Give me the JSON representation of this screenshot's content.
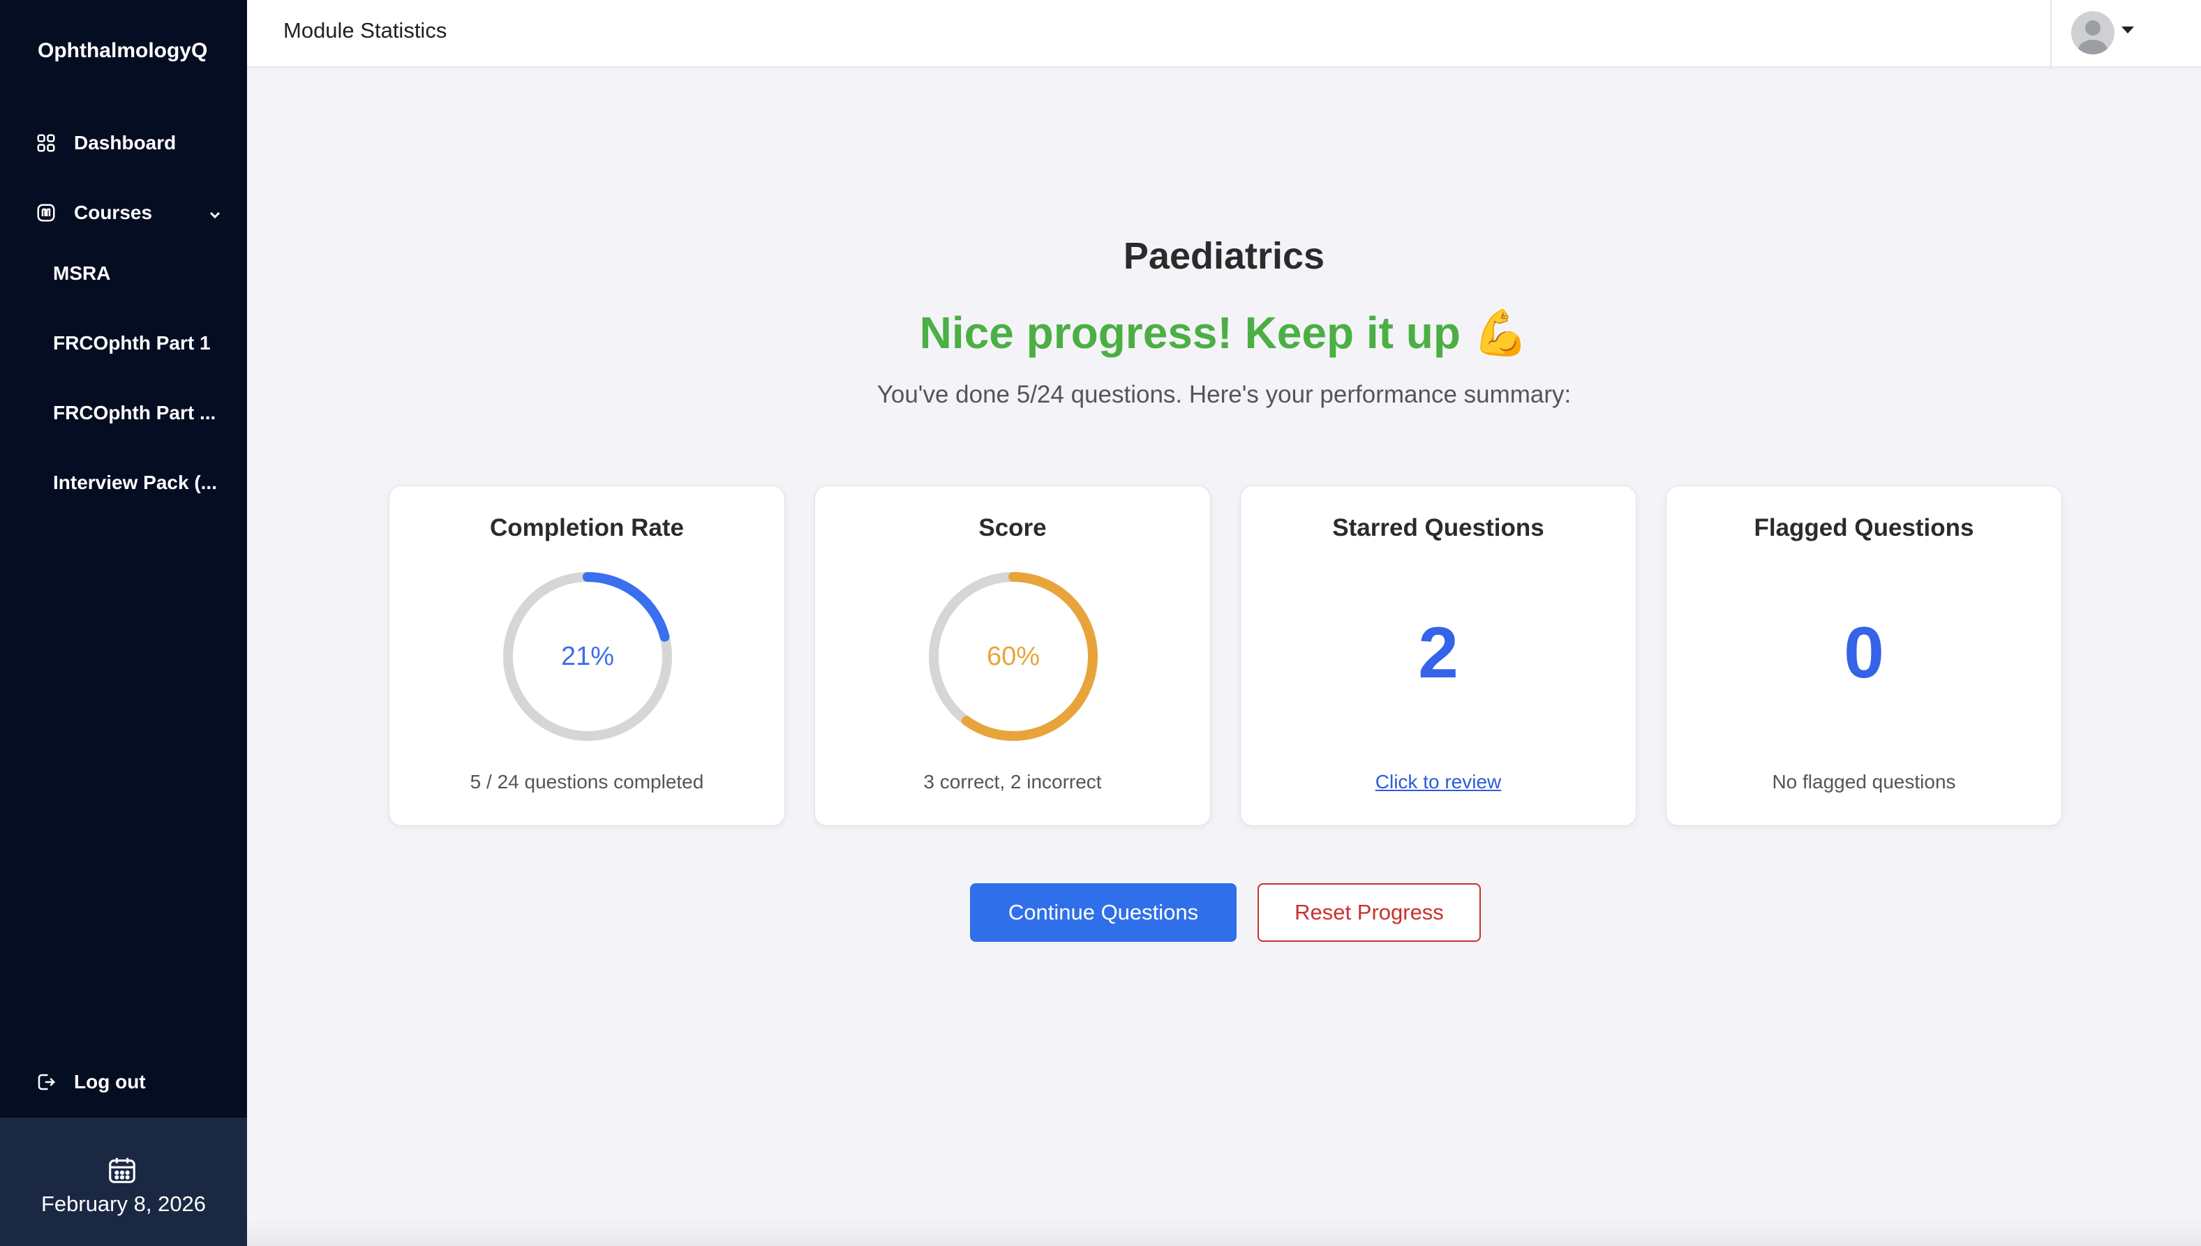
{
  "sidebar": {
    "brand": "OphthalmologyQ",
    "nav": [
      {
        "label": "Dashboard",
        "icon": "dashboard-grid-icon"
      },
      {
        "label": "Courses",
        "icon": "courses-icon"
      }
    ],
    "courses": [
      "MSRA",
      "FRCOphth Part 1",
      "FRCOphth Part ...",
      "Interview Pack (..."
    ],
    "logout": {
      "label": "Log out",
      "icon": "logout-icon"
    },
    "date": "February 8, 2026"
  },
  "header": {
    "title": "Module Statistics"
  },
  "main": {
    "module_title": "Paediatrics",
    "progress_message": "Nice progress! Keep it up 💪",
    "summary": "You've done 5/24 questions. Here's your performance summary:",
    "cards": {
      "completion": {
        "title": "Completion Rate",
        "percent": 21,
        "label": "21%",
        "footer": "5 / 24 questions completed",
        "color": "#3a6ff0"
      },
      "score": {
        "title": "Score",
        "percent": 60,
        "label": "60%",
        "footer": "3 correct, 2 incorrect",
        "color": "#e8a43a"
      },
      "starred": {
        "title": "Starred Questions",
        "count": "2",
        "link": "Click to review"
      },
      "flagged": {
        "title": "Flagged Questions",
        "count": "0",
        "footer": "No flagged questions"
      }
    },
    "buttons": {
      "continue": "Continue Questions",
      "reset": "Reset Progress"
    }
  },
  "colors": {
    "sidebar_bg": "#040d21",
    "accent_blue": "#2f6fea",
    "success_green": "#4caf44",
    "danger_red": "#c9302c",
    "ring_track": "#d6d6d6"
  }
}
